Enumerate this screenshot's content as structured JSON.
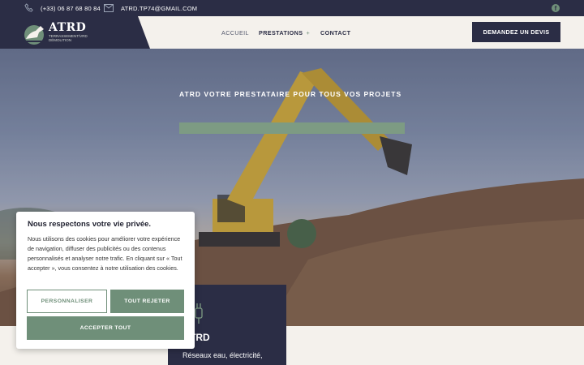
{
  "topbar": {
    "phone": "(+33) 06 87 68 80 84",
    "email": "ATRD.TP74@GMAIL.COM",
    "phone_icon": "phone-icon",
    "mail_icon": "mail-icon",
    "social_icon": "facebook-icon"
  },
  "header": {
    "logo_title": "ATRD",
    "logo_subtitle": "TERRASSEMENT/VRD DÉMOLITION",
    "nav": [
      "ACCUEIL",
      "PRESTATIONS",
      "CONTACT"
    ],
    "nav_plus": "+",
    "cta_label": "DEMANDEZ UN DEVIS"
  },
  "hero": {
    "title": "ATRD VOTRE PRESTATAIRE POUR TOUS VOS PROJETS"
  },
  "service_card": {
    "title": "TRD",
    "description": "Réseaux eau, électricité,"
  },
  "cookie": {
    "title": "Nous respectons votre vie privée.",
    "text": "Nous utilisons des cookies pour améliorer votre expérience de navigation, diffuser des publicités ou des contenus personnalisés et analyser notre trafic. En cliquant sur « Tout accepter », vous consentez à notre utilisation des cookies.",
    "customize_label": "PERSONNALISER",
    "reject_label": "TOUT REJETER",
    "accept_label": "ACCEPTER TOUT"
  },
  "colors": {
    "navy": "#2b2d45",
    "sage": "#6f8f79",
    "cream": "#f4f1ec"
  }
}
